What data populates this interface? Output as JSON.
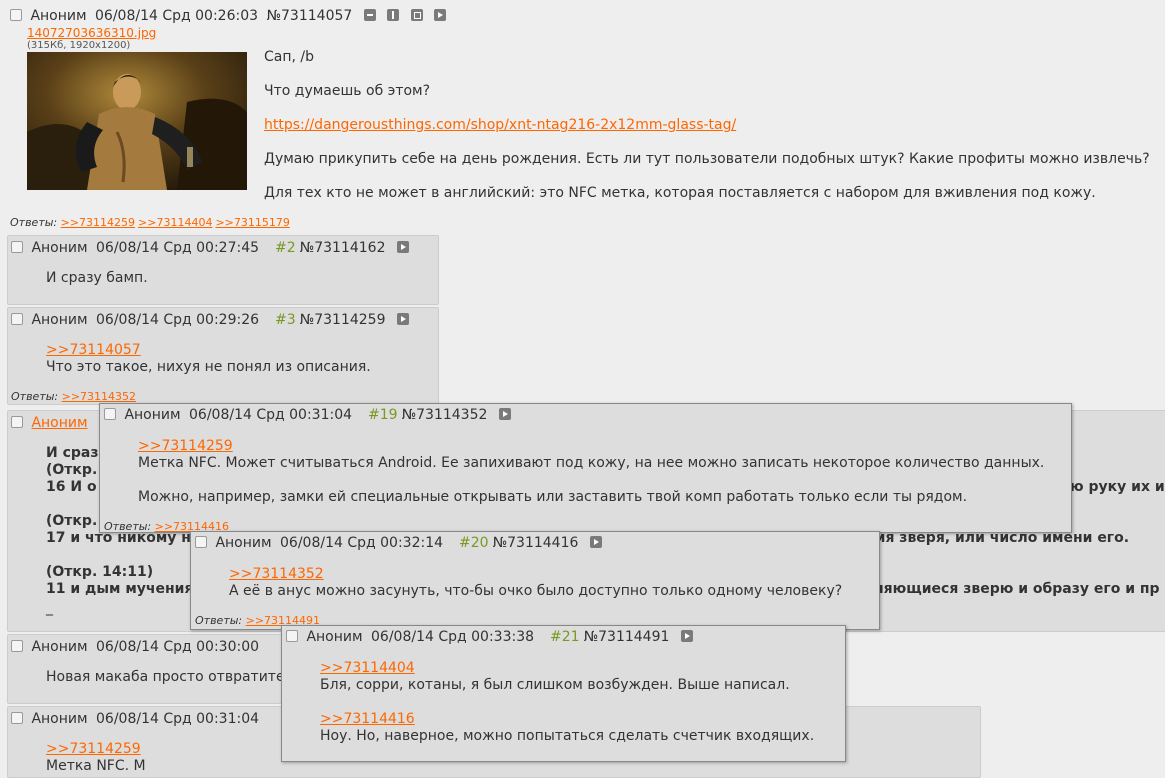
{
  "op": {
    "name": "Аноним",
    "date": "06/08/14 Срд 00:26:03",
    "num": "№73114057",
    "file_name": "14072703636310.jpg",
    "file_meta": "(315Кб, 1920x1200)",
    "lines": [
      "Сап, /b",
      "Что думаешь об этом?",
      "Думаю прикупить себе на день рождения. Есть ли тут пользователи подобных штук? Какие профиты можно извлечь?",
      "Для тех кто не может в английский: это NFC метка, которая поставляется с набором для вживления под кожу."
    ],
    "link": "https://dangerousthings.com/shop/xnt-ntag216-2x12mm-glass-tag/",
    "answers_label": "Ответы:",
    "answers": [
      ">>73114259",
      ">>73114404",
      ">>73115179"
    ]
  },
  "r2": {
    "name": "Аноним",
    "date": "06/08/14 Срд 00:27:45",
    "idx": "#2",
    "num": "№73114162",
    "text": "И сразу бамп."
  },
  "r3": {
    "name": "Аноним",
    "date": "06/08/14 Срд 00:29:26",
    "idx": "#3",
    "num": "№73114259",
    "quote": ">>73114057",
    "text": "Что это такое, нихуя не понял из описания.",
    "answers_label": "Ответы:",
    "answers": [
      ">>73114352"
    ]
  },
  "r4": {
    "name": "Аноним",
    "l1a": "И сраз",
    "l2a": "(Откр.",
    "l3a": "16 И о",
    "l3b": "ю руку их ил",
    "l4a": "(Откр.",
    "l5a": "17 и что никому н",
    "l5b": "мя зверя, или число имени его.",
    "l6": "(Откр. 14:11)",
    "l7a": "11 и дым мучения",
    "l7b": "няющиеся зверю и образу его и пр",
    "l8": "_"
  },
  "r5": {
    "name": "Аноним",
    "date": "06/08/14 Срд 00:30:00",
    "text": "Новая макаба просто отвратител"
  },
  "r6": {
    "name": "Аноним",
    "date": "06/08/14 Срд 00:31:04",
    "quote": ">>73114259",
    "text": "Метка NFC. М"
  },
  "p19": {
    "name": "Аноним",
    "date": "06/08/14 Срд 00:31:04",
    "idx": "#19",
    "num": "№73114352",
    "quote": ">>73114259",
    "text1": "Метка NFC. Может считываться Android. Ее запихивают под кожу, на нее можно записать некоторое количество данных.",
    "text2": "Можно, например, замки ей специальные открывать или заставить твой комп работать только если ты рядом.",
    "answers_label": "Ответы:",
    "answers": [
      ">>73114416"
    ]
  },
  "p20": {
    "name": "Аноним",
    "date": "06/08/14 Срд 00:32:14",
    "idx": "#20",
    "num": "№73114416",
    "quote": ">>73114352",
    "text": "А её в анус можно засунуть, что-бы очко было доступно только одному человеку?",
    "answers_label": "Ответы:",
    "answers": [
      ">>73114491"
    ]
  },
  "p21": {
    "name": "Аноним",
    "date": "06/08/14 Срд 00:33:38",
    "idx": "#21",
    "num": "№73114491",
    "quote1": ">>73114404",
    "text1": "Бля, сорри, котаны, я был слишком возбужден. Выше написал.",
    "quote2": ">>73114416",
    "text2": "Ноу. Но, наверное, можно попытаться сделать счетчик входящих."
  }
}
